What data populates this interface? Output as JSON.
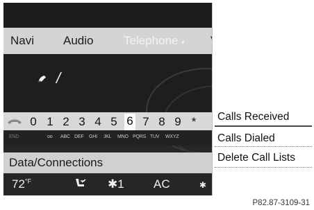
{
  "menu": {
    "navi": "Navi",
    "audio": "Audio",
    "telephone": "Telephone",
    "more": "V"
  },
  "call_display": {
    "handset_icon": "phone-handset-icon",
    "input_cursor": "/"
  },
  "keypad": {
    "keys": [
      "0",
      "1",
      "2",
      "3",
      "4",
      "5",
      "6",
      "7",
      "8",
      "9",
      "*"
    ],
    "selected_key": "6",
    "sublabels": [
      "END",
      "oo",
      "ABC",
      "DEF",
      "GHI",
      "JKL",
      "MNO",
      "PQRS",
      "TUV",
      "WXYZ"
    ]
  },
  "data_connections": "Data/Connections",
  "climate": {
    "temperature": "72",
    "unit": "°F",
    "fan_level": "1",
    "ac_label": "AC"
  },
  "call_lists_menu": {
    "items": [
      "Calls Received",
      "Calls Dialed",
      "Delete Call Lists"
    ],
    "selected_index": 0
  },
  "caption": "P82.87-3109-31"
}
